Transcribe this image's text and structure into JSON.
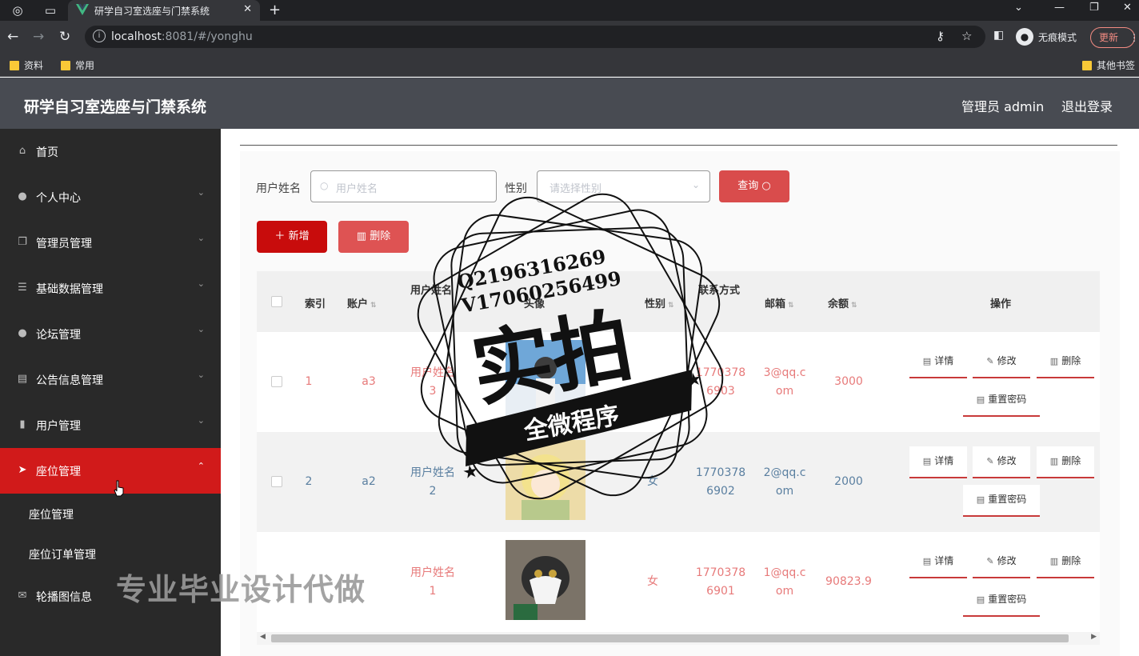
{
  "browser": {
    "tab_title": "研学自习室选座与门禁系统",
    "url_host": "localhost",
    "url_rest": ":8081/#/yonghu",
    "incognito_label": "无痕模式",
    "update_label": "更新",
    "bookmarks": [
      "资料",
      "常用"
    ],
    "other_bookmarks": "其他书签"
  },
  "header": {
    "title": "研学自习室选座与门禁系统",
    "user_label": "管理员 admin",
    "logout_label": "退出登录"
  },
  "sidebar": {
    "items": [
      {
        "label": "首页",
        "icon": "home-icon"
      },
      {
        "label": "个人中心",
        "icon": "user-icon"
      },
      {
        "label": "管理员管理",
        "icon": "copy-icon"
      },
      {
        "label": "基础数据管理",
        "icon": "list-icon"
      },
      {
        "label": "论坛管理",
        "icon": "bulb-icon"
      },
      {
        "label": "公告信息管理",
        "icon": "notice-icon"
      },
      {
        "label": "用户管理",
        "icon": "chart-icon"
      },
      {
        "label": "座位管理",
        "icon": "plane-icon",
        "active": true
      },
      {
        "label": "轮播图信息",
        "icon": "mail-icon"
      }
    ],
    "sub_items": [
      "座位管理",
      "座位订单管理"
    ]
  },
  "search": {
    "name_label": "用户姓名",
    "name_placeholder": "用户姓名",
    "gender_label": "性别",
    "gender_placeholder": "请选择性别",
    "query_button": "查询"
  },
  "actions": {
    "add_label": "新增",
    "delete_label": "删除"
  },
  "table": {
    "columns": {
      "index": "索引",
      "account": "账户",
      "name": "用户姓名",
      "avatar": "头像",
      "gender": "性别",
      "phone": "联系方式",
      "email": "邮箱",
      "balance": "余额",
      "ops": "操作"
    },
    "rows": [
      {
        "index": "1",
        "account": "a3",
        "name_l1": "用户姓名",
        "name_l2": "3",
        "gender": "",
        "phone_l1": "1770378",
        "phone_l2": "6903",
        "email_l1": "3@qq.c",
        "email_l2": "om",
        "balance": "3000",
        "avatar": "sky-photo"
      },
      {
        "index": "2",
        "account": "a2",
        "name_l1": "用户姓名",
        "name_l2": "2",
        "gender": "女",
        "phone_l1": "1770378",
        "phone_l2": "6902",
        "email_l1": "2@qq.c",
        "email_l2": "om",
        "balance": "2000",
        "avatar": "anime-photo"
      },
      {
        "index": "",
        "account": "",
        "name_l1": "用户姓名",
        "name_l2": "1",
        "gender": "女",
        "phone_l1": "1770378",
        "phone_l2": "6901",
        "email_l1": "1@qq.c",
        "email_l2": "om",
        "balance": "90823.9",
        "avatar": "cat-photo"
      }
    ],
    "op_labels": {
      "detail": "详情",
      "edit": "修改",
      "delete": "删除",
      "reset": "重置密码"
    }
  },
  "overlay": {
    "contact_q": "Q2196316269",
    "contact_v": "V17060256499",
    "stamp_big": "实拍",
    "stamp_banner": "全微程序",
    "bottom_watermark": "专业毕业设计代做"
  },
  "colors": {
    "accent_red": "#d11a1a",
    "header_bg": "#484b52",
    "sidebar_bg": "#292929"
  }
}
